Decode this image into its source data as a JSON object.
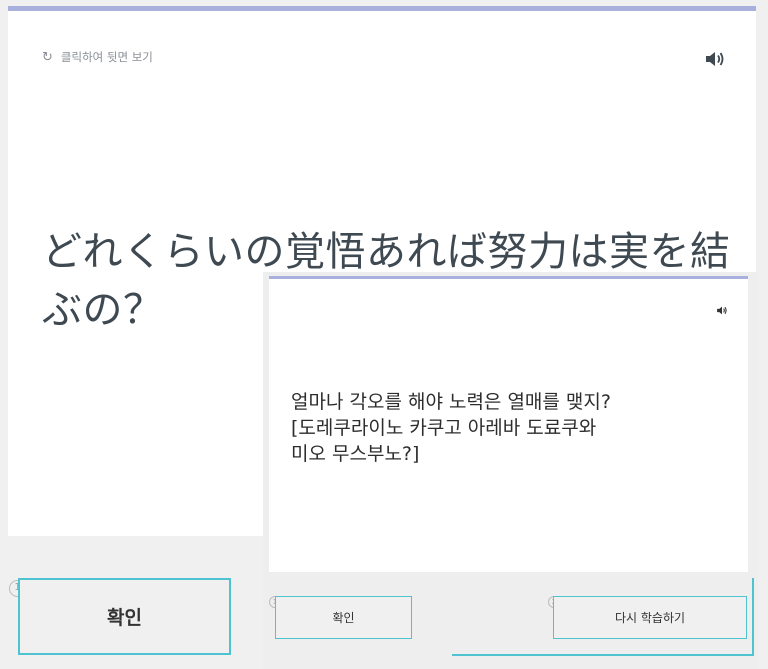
{
  "main_card": {
    "flip_hint_icon": "refresh-icon",
    "flip_hint": "클릭하여 뒷면 보기",
    "speaker_icon": "speaker-icon",
    "front_text": "どれくらいの覚悟あれば努力は実を結ぶの？"
  },
  "buttons": {
    "step1_number": "1",
    "confirm_label": "확인",
    "step2_number": "2",
    "relearn_label": "다시 학습하기"
  },
  "overlay_card": {
    "speaker_icon": "speaker-icon",
    "back_text_line1": "얼마나 각오를 해야 노력은 열매를 맺지?",
    "back_text_line2": "[도레쿠라이노 카쿠고 아레바 도료쿠와",
    "back_text_line3": "미오 무스부노?]"
  },
  "colors": {
    "accent_border": "#4fc3cf",
    "card_top_border": "#a8b0dd",
    "text_dark": "#3e4952"
  }
}
